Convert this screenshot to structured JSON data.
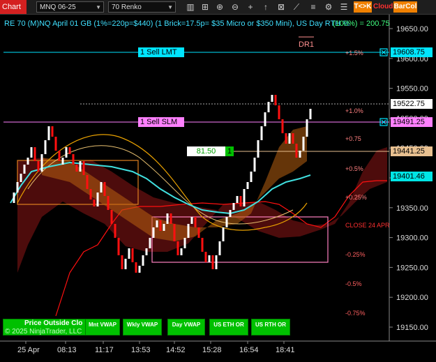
{
  "toolbar": {
    "tab_label": "Chart",
    "instrument": "MNQ 06-25",
    "bar_type": "70 Renko",
    "btn_tk": "T<>K",
    "btn_cloud": "Cloud",
    "btn_barcol": "BarCol",
    "icons": [
      "bars-icon",
      "crosshair-icon",
      "pencil-icon",
      "zoom-in-icon",
      "zoom-out-icon",
      "crosshair-plus-icon",
      "arrow-up-icon",
      "pin-icon",
      "grid-icon",
      "line-tool-icon",
      "fib-icon",
      "settings-icon",
      "list-icon"
    ]
  },
  "chart": {
    "info_line": "RE 70 (M)NQ April 01 GB (1%=220p=$440) (1 Brick=17.5p= $35 Micro or $350 Mini), US Day RTH %",
    "info_right": "(100%) = 200.75",
    "dr_label": "DR1",
    "copyright": "© 2025 NinjaTrader, LLC",
    "price_outside": "Price Outside Clo",
    "close_label": "CLOSE 24 APR",
    "order_sell_lmt": "1 Sell LMT",
    "order_sell_slm": "1 Sell SLM",
    "position_pnl": "81.50",
    "position_qty": "1"
  },
  "legend_buttons": [
    {
      "label": "Mnt VWAP"
    },
    {
      "label": "Wkly VWAP"
    },
    {
      "label": "Day VWAP"
    },
    {
      "label": "US ETH OR"
    },
    {
      "label": "US RTH OR"
    }
  ],
  "price_axis": {
    "ticks": [
      "19650.00",
      "19600.00",
      "19550.00",
      "19500.00",
      "19450.00",
      "19400.00",
      "19350.00",
      "19300.00",
      "19250.00",
      "19200.00",
      "19150.00"
    ],
    "tags": [
      {
        "text": "19608.75",
        "bg": "#00e5ff",
        "fg": "#000"
      },
      {
        "text": "19522.75",
        "bg": "#ffffff",
        "fg": "#000"
      },
      {
        "text": "19491.25",
        "bg": "#ff80ff",
        "fg": "#000"
      },
      {
        "text": "19441.25",
        "bg": "#e8c090",
        "fg": "#000"
      },
      {
        "text": "19401.46",
        "bg": "#00e5e5",
        "fg": "#000"
      }
    ]
  },
  "pct_labels": [
    "+1.5%",
    "+1.0%",
    "+0.75",
    "+0.5%",
    "+0.25%",
    "-0.25%",
    "-0.5%",
    "-0.75%"
  ],
  "time_axis": [
    "25 Apr",
    "08:13",
    "11:17",
    "13:53",
    "14:52",
    "15:28",
    "16:54",
    "18:41"
  ],
  "colors": {
    "up_brick": "#ffffff",
    "down_brick": "#ff1010",
    "cyan": "#40e0e0",
    "orange": "#e08020",
    "cloud": "#5a0e0e",
    "pink": "#ff80c0",
    "green_btn": "#00c000"
  }
}
